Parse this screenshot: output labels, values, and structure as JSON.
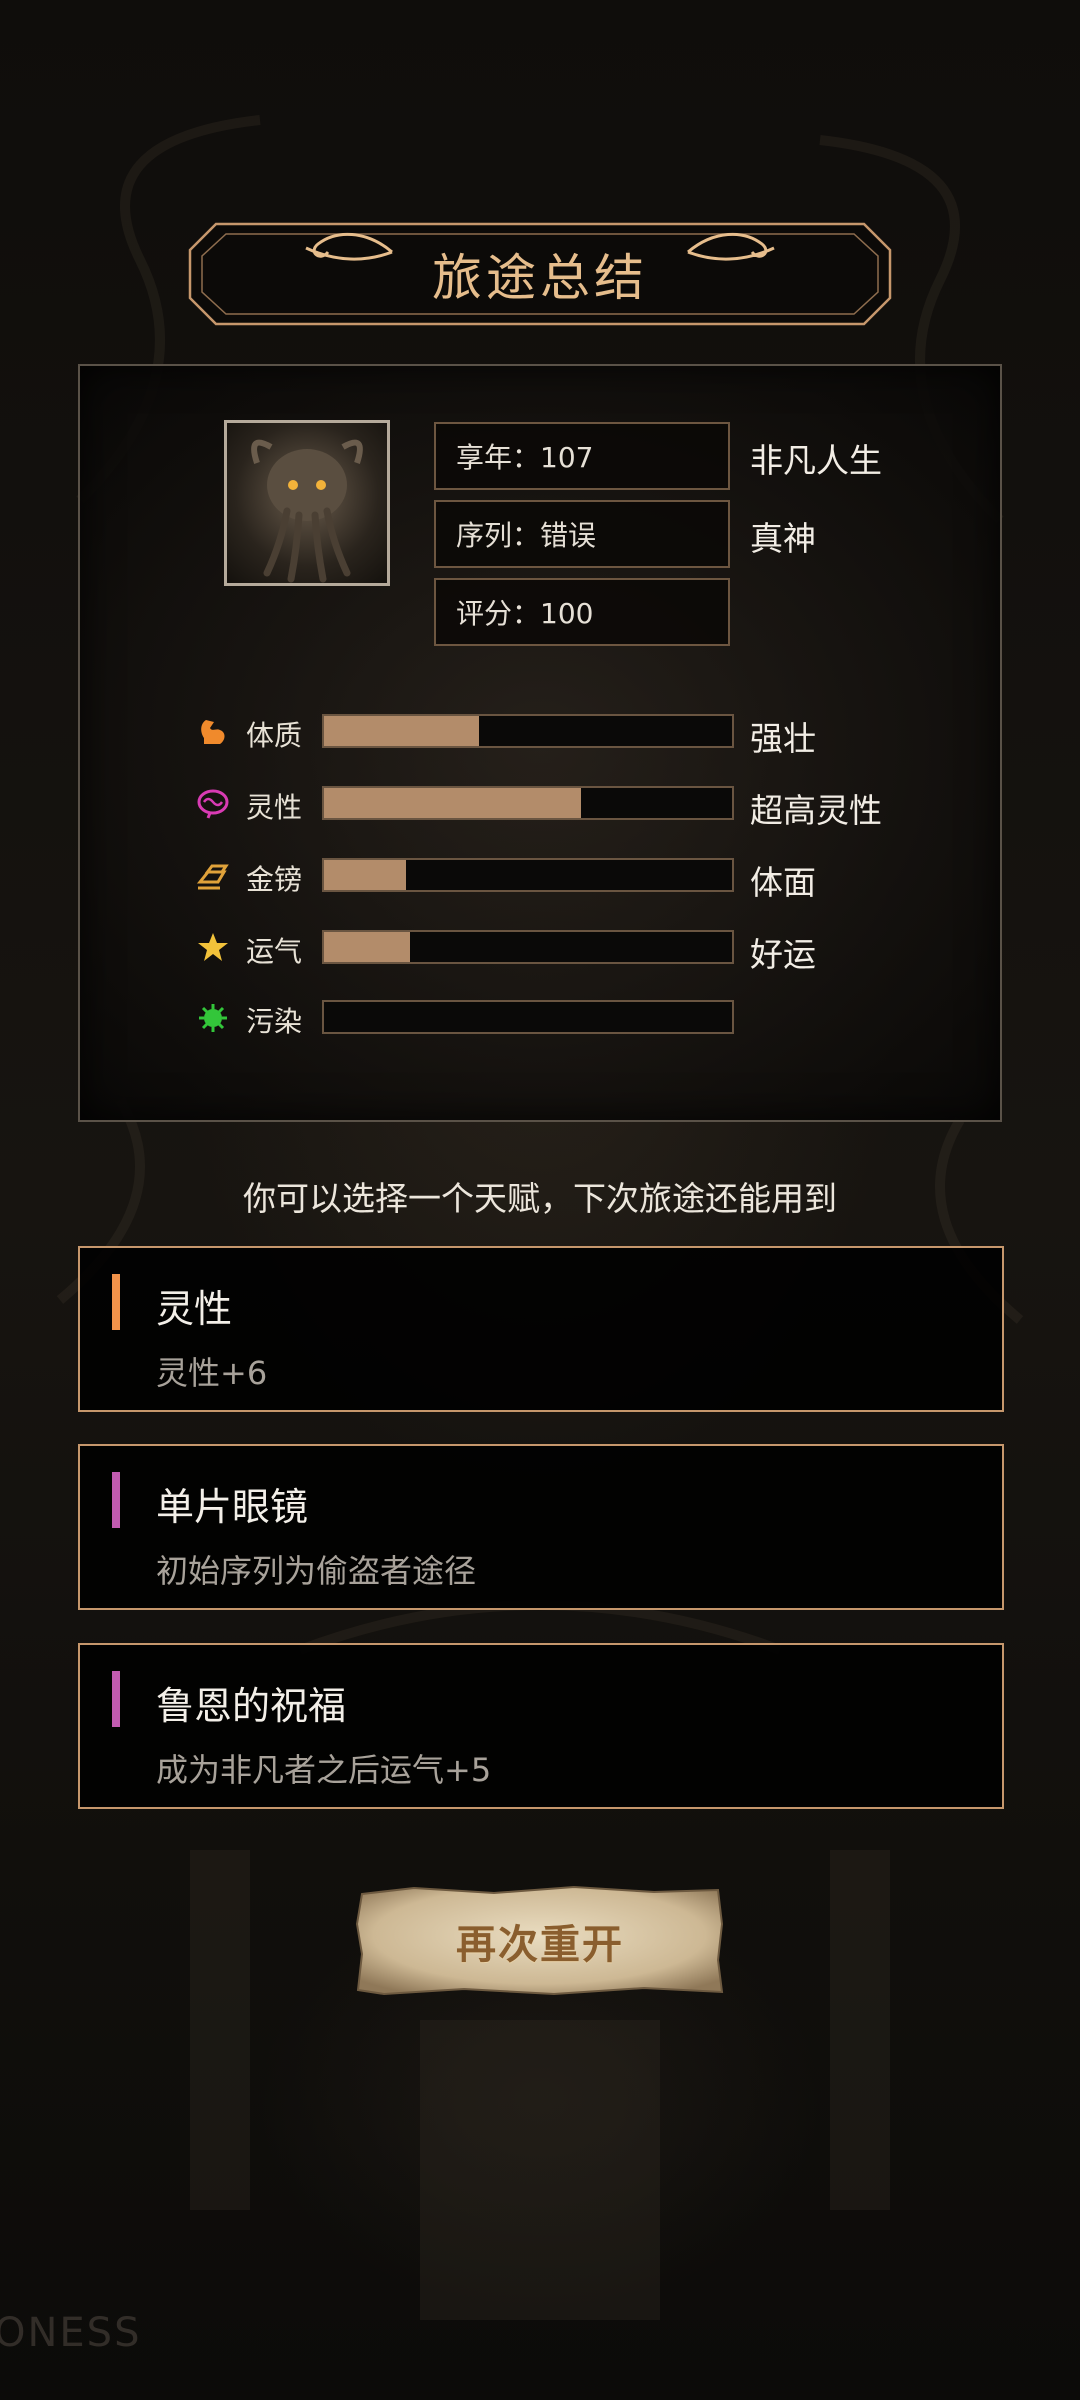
{
  "title": "旅途总结",
  "summary": {
    "info": [
      {
        "label": "享年：107",
        "tag": "非凡人生"
      },
      {
        "label": "序列：错误",
        "tag": "真神"
      },
      {
        "label": "评分：100",
        "tag": ""
      }
    ],
    "stats": [
      {
        "icon": "muscle-icon",
        "label": "体质",
        "fill": 0.38,
        "tag": "强壮",
        "color": "#f08a2c"
      },
      {
        "icon": "brain-icon",
        "label": "灵性",
        "fill": 0.63,
        "tag": "超高灵性",
        "color": "#d93bb4"
      },
      {
        "icon": "gold-bars-icon",
        "label": "金镑",
        "fill": 0.2,
        "tag": "体面",
        "color": "#e0a23a"
      },
      {
        "icon": "star-icon",
        "label": "运气",
        "fill": 0.21,
        "tag": "好运",
        "color": "#f2c23a"
      },
      {
        "icon": "virus-icon",
        "label": "污染",
        "fill": 0.0,
        "tag": "",
        "color": "#33c63a"
      }
    ]
  },
  "prompt": "你可以选择一个天赋，下次旅途还能用到",
  "talents": [
    {
      "name": "灵性",
      "desc": "灵性+6",
      "accent": "#f2934a"
    },
    {
      "name": "单片眼镜",
      "desc": "初始序列为偷盗者途径",
      "accent": "#c25bb0"
    },
    {
      "name": "鲁恩的祝福",
      "desc": "成为非凡者之后运气+5",
      "accent": "#c25bb0"
    }
  ],
  "restart_label": "再次重开",
  "watermark": "ONESS"
}
